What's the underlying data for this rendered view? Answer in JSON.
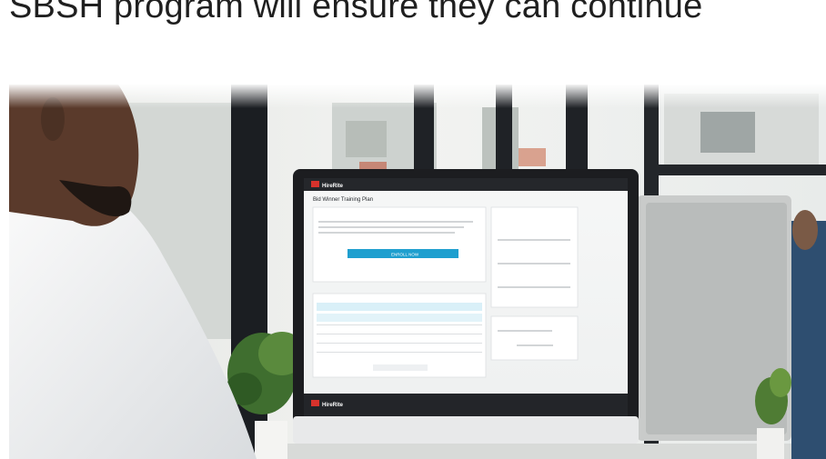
{
  "article": {
    "headline_fragment": "SBSH program will ensure they can continue"
  },
  "photo": {
    "screen_brand": "HireRite",
    "screen_page_title": "Bid Winner Training Plan",
    "screen_primary_button": "ENROLL NOW"
  }
}
